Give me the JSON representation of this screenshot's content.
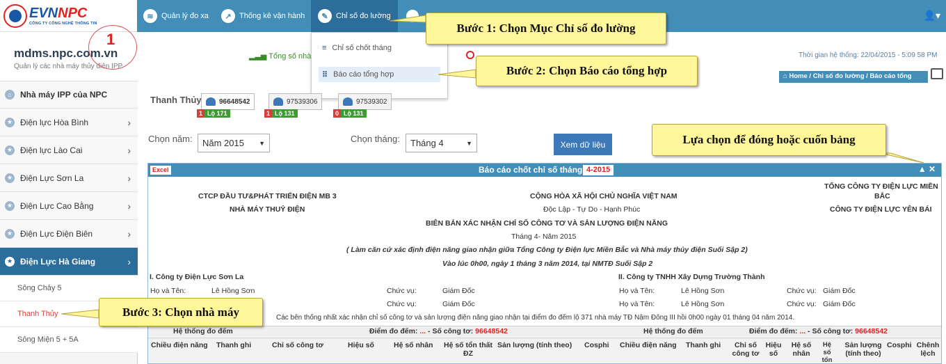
{
  "brand": {
    "name_a": "EVN",
    "name_b": "NPC",
    "subtitle": "CÔNG TY CÔNG NGHỆ THÔNG TIN"
  },
  "nav": [
    {
      "label": "Quản lý đo xa",
      "icon": "wifi-icon"
    },
    {
      "label": "Thống kê vận hành",
      "icon": "chart-line-icon"
    },
    {
      "label": "Chỉ số đo lường",
      "icon": "edit-icon"
    }
  ],
  "user_icon": "user-icon",
  "site": {
    "title": "mdms.npc.com.vn",
    "subtitle": "Quản lý các nhà máy thủy điện IPP",
    "marker": "1"
  },
  "header": {
    "tong_so": "Tổng số nhà m",
    "time": "Thời gian hệ thống: 22/04/2015 - 5:09 58 PM"
  },
  "breadcrumb": "Home / Chỉ số đo lường / Báo cáo tổng",
  "dropdown": {
    "items": [
      "Chỉ số chốt tháng",
      "Báo cáo tổng hợp"
    ]
  },
  "sidebar": {
    "items": [
      "Nhà máy IPP của NPC",
      "Điện lực Hòa Bình",
      "Điện lực Lào Cai",
      "Điện Lực Sơn La",
      "Điện Lực Cao Bằng",
      "Điện Lực Điện Biên",
      "Điện Lực Hà Giang"
    ],
    "subs": [
      "Sông Chảy 5",
      "Thanh Thủy",
      "Sông Miện 5 + 5A"
    ]
  },
  "plant": {
    "name": "Thanh Thủy",
    "meters": [
      {
        "id": "96648542",
        "count": "1",
        "lo": "Lộ 171"
      },
      {
        "id": "97539306",
        "count": "1",
        "lo": "Lộ 131"
      },
      {
        "id": "97539302",
        "count": "0",
        "lo": "Lộ 131"
      }
    ]
  },
  "filters": {
    "year_label": "Chọn năm:",
    "year": "Năm 2015",
    "month_label": "Chọn tháng:",
    "month": "Tháng 4",
    "view": "Xem dữ liệu"
  },
  "panel": {
    "excel": "Excel",
    "title": "Báo cáo chốt chỉ số tháng:",
    "month": "4-2015",
    "tools": "▲ ✕"
  },
  "doc": {
    "l1": "CTCP ĐẦU TƯ&PHÁT TRIỂN ĐIỆN MB 3",
    "l2": "NHÀ MÁY THUỶ ĐIỆN",
    "c1": "CỘNG HÒA XÃ HỘI CHỦ NGHĨA VIỆT NAM",
    "c2": "Độc Lập - Tự Do - Hạnh Phúc",
    "r1": "TỔNG CÔNG TY ĐIỆN LỰC MIỀN",
    "r1b": "BẮC",
    "r2": "CÔNG TY ĐIỆN LỰC YÊN BÁI",
    "t1": "BIÊN BẢN XÁC NHẬN CHỈ SỐ CÔNG TƠ VÀ SẢN LƯỢNG ĐIỆN NĂNG",
    "t2": "Tháng 4- Năm 2015",
    "t3": "( Làm căn cứ xác định điện năng giao nhận giữa Tổng Công ty Điện lực Miền Bắc và Nhà máy thủy điện Suối Sập 2)",
    "t4": "Vào lúc 0h00, ngày 1 tháng 3 năm 2014, tại NMTĐ Suối Sập 2",
    "p1": "I. Công ty Điện Lực Sơn La",
    "p2": "II. Công ty TNHH Xây Dựng Trường Thành",
    "hvt": "Họ và Tên:",
    "name": "Lê Hồng Sơn",
    "cv": "Chức vụ:",
    "pos": "Giám Đốc",
    "agree": "Các bên thống nhất xác nhận chỉ số công tơ và sản lượng điện năng giao nhận tại điểm đo đếm lộ 371 nhà máy TĐ Nậm Đông III hồi 0h00 ngày 01 tháng 04 năm 2014.",
    "sys": "Hệ thống đo đếm",
    "dd_a": "Điểm đo đếm: ",
    "dd_dots": "...",
    "dd_b": " - Số công tơ: ",
    "meter": "96648542",
    "cols": [
      "Chiều điện năng",
      "Thanh ghi",
      "Chỉ số công tơ",
      "Hiệu số",
      "Hệ số nhân",
      "Hệ số tổn thất ĐZ",
      "Sản lượng (tính theo)",
      "Cosphi",
      "Chiều điện năng",
      "Thanh ghi",
      "Chỉ số công tơ",
      "Hiệu số",
      "Hệ số nhân",
      "Hệ số tổn",
      "Sản lượng (tính theo)",
      "Cosphi",
      "Chênh lệch"
    ]
  },
  "callouts": {
    "s1": "Bước 1: Chọn Mục Chỉ số đo lường",
    "s2": "Bước 2:  Chọn Báo cáo tổng hợp",
    "s3": "Bước 3:  Chọn nhà máy",
    "s4": "Lựa chọn để đóng hoặc cuốn bảng"
  }
}
